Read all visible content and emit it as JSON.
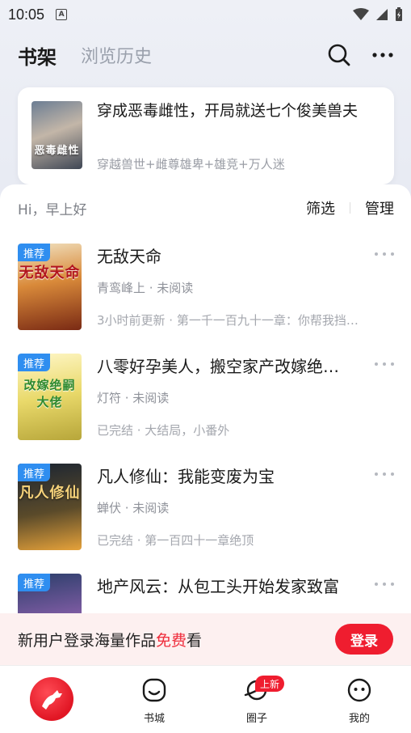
{
  "status_bar": {
    "time": "10:05",
    "a_icon": "A"
  },
  "header": {
    "tab_shelf": "书架",
    "tab_history": "浏览历史"
  },
  "recent": {
    "title": "穿成恶毒雌性，开局就送七个俊美兽夫",
    "tags": "穿越兽世+雌尊雄卑+雄竞+万人迷",
    "cover_text": "恶毒雌性"
  },
  "sheet": {
    "greeting": "Hi，早上好",
    "filter": "筛选",
    "manage": "管理"
  },
  "books": [
    {
      "badge": "推荐",
      "cover_text": "无敌天命",
      "title": "无敌天命",
      "meta": "青鸾峰上 · 未阅读",
      "update": "3小时前更新 · 第一千一百九十一章：你帮我挡…"
    },
    {
      "badge": "推荐",
      "cover_text": "改嫁绝嗣大佬",
      "title": "八零好孕美人，搬空家产改嫁绝…",
      "meta": "灯符 · 未阅读",
      "update": "已完结 · 大结局，小番外"
    },
    {
      "badge": "推荐",
      "cover_text": "凡人修仙",
      "title": "凡人修仙：我能变废为宝",
      "meta": "蝉伏 · 未阅读",
      "update": "已完结 · 第一百四十一章绝顶"
    },
    {
      "badge": "推荐",
      "cover_text": "",
      "title": "地产风云：从包工头开始发家致富",
      "meta": "",
      "update": ""
    }
  ],
  "login_banner": {
    "text_before": "新用户登录海量作品",
    "text_free": "免费",
    "text_after": "看",
    "button": "登录"
  },
  "bottom_nav": {
    "store": "书城",
    "circle": "圈子",
    "circle_badge": "上新",
    "mine": "我的"
  },
  "colors": {
    "accent": "#ef1d2f",
    "badge_blue": "#2f8ef0"
  }
}
